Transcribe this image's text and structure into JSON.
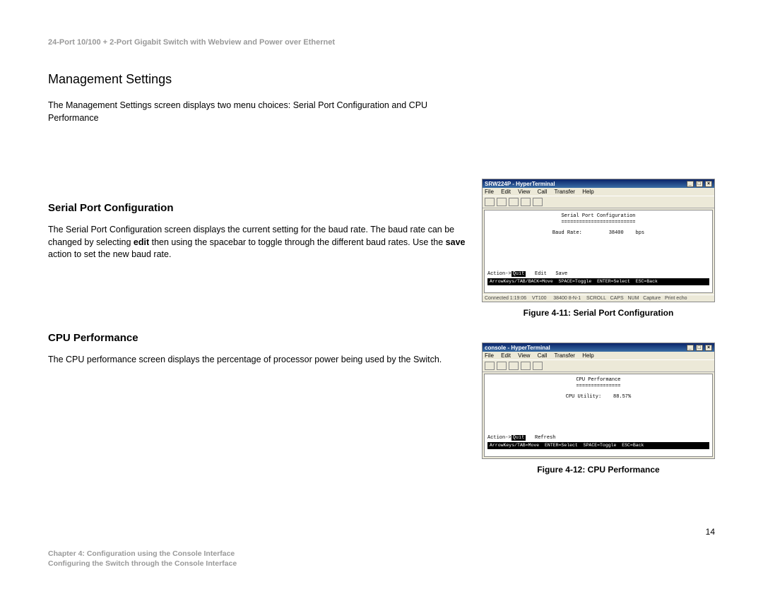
{
  "header": "24-Port 10/100 + 2-Port Gigabit Switch with Webview and Power over Ethernet",
  "section": {
    "title": "Management Settings",
    "intro": "The Management Settings screen displays two menu choices: Serial Port Configuration and CPU Performance"
  },
  "serial": {
    "title": "Serial Port Configuration",
    "text_before_edit": "The Serial Port Configuration screen displays the current setting for the baud rate. The baud rate can be changed by selecting ",
    "edit_word": "edit",
    "text_mid": " then using the spacebar to toggle through the different baud rates. Use the ",
    "save_word": "save",
    "text_after": " action to set the new baud rate."
  },
  "cpu": {
    "title": "CPU Performance",
    "text": "The CPU performance screen displays the percentage of processor power being used by the Switch."
  },
  "fig1": {
    "caption": "Figure 4-11: Serial Port Configuration",
    "win_title": "SRW224P - HyperTerminal",
    "menu": [
      "File",
      "Edit",
      "View",
      "Call",
      "Transfer",
      "Help"
    ],
    "screen_title": "Serial Port Configuration",
    "screen_row": "Baud Rate:         38400    bps",
    "action_left": "Action->",
    "action_highlight": "Quit",
    "action_rest": "   Edit   Save",
    "hint": "ArrowKeys/TAB/BACK=Move  SPACE=Toggle  ENTER=Select  ESC=Back",
    "status": "Connected 1:19:06    VT100     38400 8-N-1    SCROLL   CAPS   NUM   Capture   Print echo"
  },
  "fig2": {
    "caption": "Figure 4-12: CPU Performance",
    "win_title": "console - HyperTerminal",
    "menu": [
      "File",
      "Edit",
      "View",
      "Call",
      "Transfer",
      "Help"
    ],
    "screen_title": "CPU Performance",
    "screen_row": "CPU Utility:    88.57%",
    "action_left": "Action->",
    "action_highlight": "Quit",
    "action_rest": "   Refresh",
    "hint": "ArrowKeys/TAB=Move  ENTER=Select  SPACE=Toggle  ESC=Back"
  },
  "page_number": "14",
  "footer": {
    "line1": "Chapter 4: Configuration using the Console Interface",
    "line2": "Configuring the Switch through the Console Interface"
  }
}
